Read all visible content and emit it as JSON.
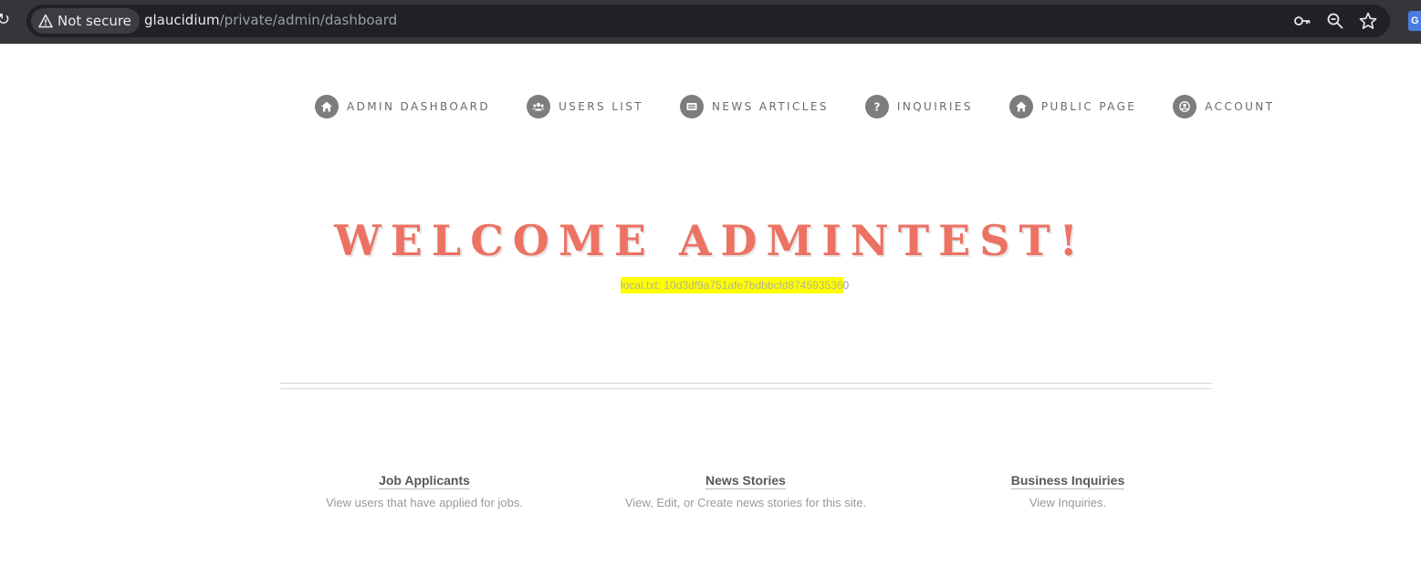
{
  "browser": {
    "security_label": "Not secure",
    "url_host": "glaucidium",
    "url_path": "/private/admin/dashboard",
    "icons": [
      "reload-icon",
      "warning-icon",
      "key-icon",
      "zoom-icon",
      "star-icon"
    ]
  },
  "nav": {
    "items": [
      {
        "label": "ADMIN DASHBOARD",
        "icon": "home-icon"
      },
      {
        "label": "USERS LIST",
        "icon": "users-icon"
      },
      {
        "label": "NEWS ARTICLES",
        "icon": "newspaper-icon"
      },
      {
        "label": "INQUIRIES",
        "icon": "question-icon"
      },
      {
        "label": "PUBLIC PAGE",
        "icon": "home-icon"
      },
      {
        "label": "ACCOUNT",
        "icon": "user-circle-icon"
      }
    ]
  },
  "main": {
    "welcome": "WELCOME ADMINTEST!",
    "flag_highlighted": "local.txt: 10d3df9a751afe7bdbbcfd874593536",
    "flag_rest": "0"
  },
  "features": [
    {
      "title": "Job Applicants",
      "desc": "View users that have applied for jobs."
    },
    {
      "title": "News Stories",
      "desc": "View, Edit, or Create news stories for this site."
    },
    {
      "title": "Business Inquiries",
      "desc": "View Inquiries."
    }
  ],
  "colors": {
    "accent": "#ec7263",
    "highlight": "#ffff00",
    "nav_icon_bg": "#7d7d7d"
  }
}
